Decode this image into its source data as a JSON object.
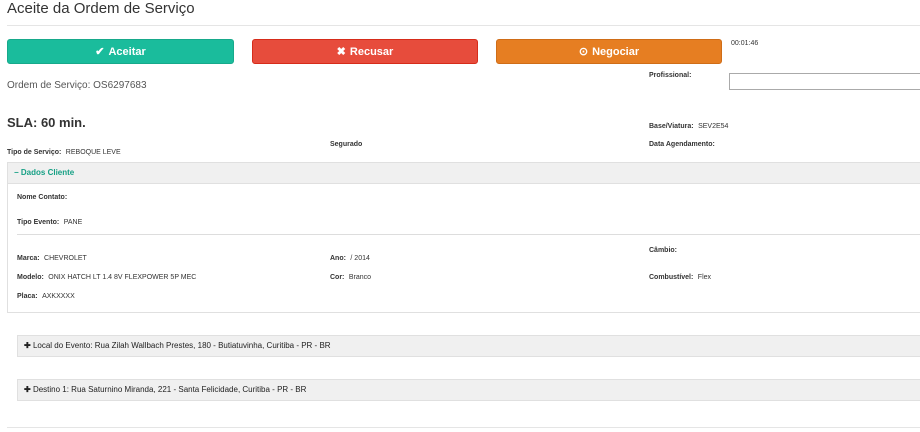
{
  "page_title": "Aceite da Ordem de Serviço",
  "buttons": {
    "accept_icon": "✔",
    "accept_label": "Aceitar",
    "refuse_icon": "✖",
    "refuse_label": "Recusar",
    "negotiate_icon": "⊙",
    "negotiate_label": "Negociar"
  },
  "timer": "00:01:46",
  "order": {
    "label": "Ordem de Serviço:",
    "number": "OS6297683"
  },
  "professional": {
    "label": "Profissional:",
    "value": ""
  },
  "sla": "SLA: 60 min.",
  "base": {
    "label": "Base/Viatura:",
    "value": "SEV2E54"
  },
  "service_type": {
    "label": "Tipo de Serviço:",
    "value": "REBOQUE LEVE"
  },
  "insured_label": "Segurado",
  "schedule_label": "Data Agendamento:",
  "client_panel": {
    "toggle_icon": "−",
    "title": "Dados Cliente",
    "contact_label": "Nome Contato:",
    "event_type_label": "Tipo Evento:",
    "event_type_value": "PANE",
    "brand_label": "Marca:",
    "brand_value": "CHEVROLET",
    "year_label": "Ano:",
    "year_value": "/ 2014",
    "gearbox_label": "Câmbio:",
    "model_label": "Modelo:",
    "model_value": "ONIX HATCH LT 1.4 8V FLEXPOWER 5P MEC",
    "color_label": "Cor:",
    "color_value": "Branco",
    "fuel_label": "Combustível:",
    "fuel_value": "Flex",
    "plate_label": "Placa:",
    "plate_value": "AXKXXXX"
  },
  "event_location": {
    "icon": "✚",
    "text": "Local do Evento: Rua Zilah Wallbach Prestes, 180 - Butiatuvinha, Curitiba - PR - BR"
  },
  "destination": {
    "icon": "✚",
    "text": "Destino 1: Rua Saturnino Miranda, 221 - Santa Felicidade, Curitiba - PR - BR"
  },
  "colors": {
    "accept": "#1abc9c",
    "refuse": "#e74c3c",
    "negotiate": "#e67e22",
    "panel_title": "#16a085"
  }
}
